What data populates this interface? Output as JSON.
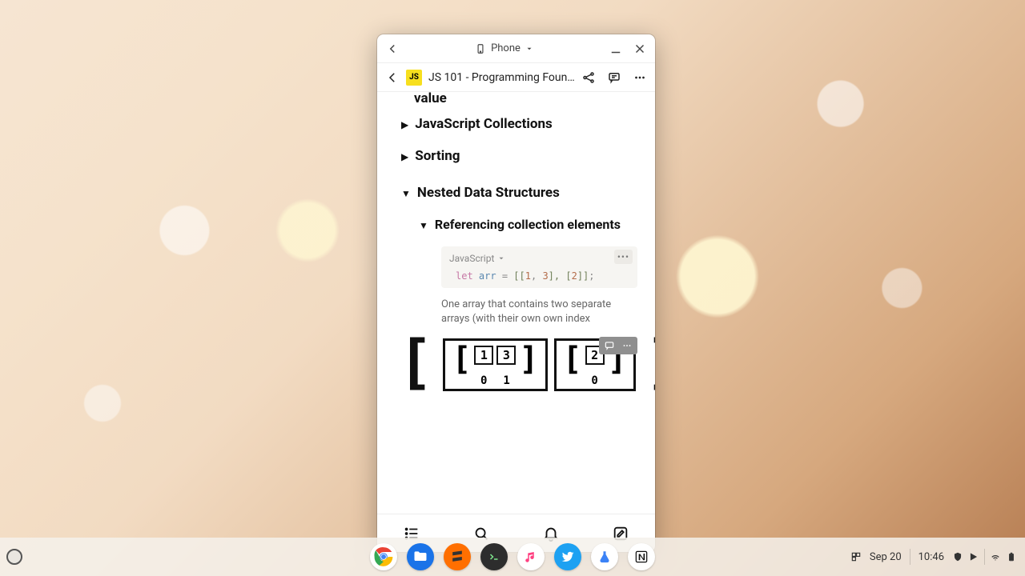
{
  "window": {
    "device_label": "Phone"
  },
  "page": {
    "icon_text": "JS",
    "title": "JS 101 - Programming Foun…"
  },
  "content": {
    "prev_heading_tail": "value",
    "h_collections": "JavaScript Collections",
    "h_sorting": "Sorting",
    "h_nested": "Nested Data Structures",
    "h_refcoll": "Referencing collection elements",
    "code": {
      "language": "JavaScript",
      "kw_let": "let",
      "ident": "arr",
      "eq": " = ",
      "open1": "[[",
      "n1": "1",
      "comma1": ", ",
      "n3": "3",
      "close_open": "], [",
      "n2": "2",
      "close2": "]]",
      "semi": ";"
    },
    "caption": "One array that contains two separate arrays (with their own own index",
    "diagram": {
      "inner1": {
        "cells": [
          "1",
          "3"
        ],
        "indices": [
          "0",
          "1"
        ]
      },
      "inner2": {
        "cells": [
          "2"
        ],
        "indices": [
          "0"
        ]
      }
    }
  },
  "shelf": {
    "date": "Sep 20",
    "time": "10:46"
  }
}
